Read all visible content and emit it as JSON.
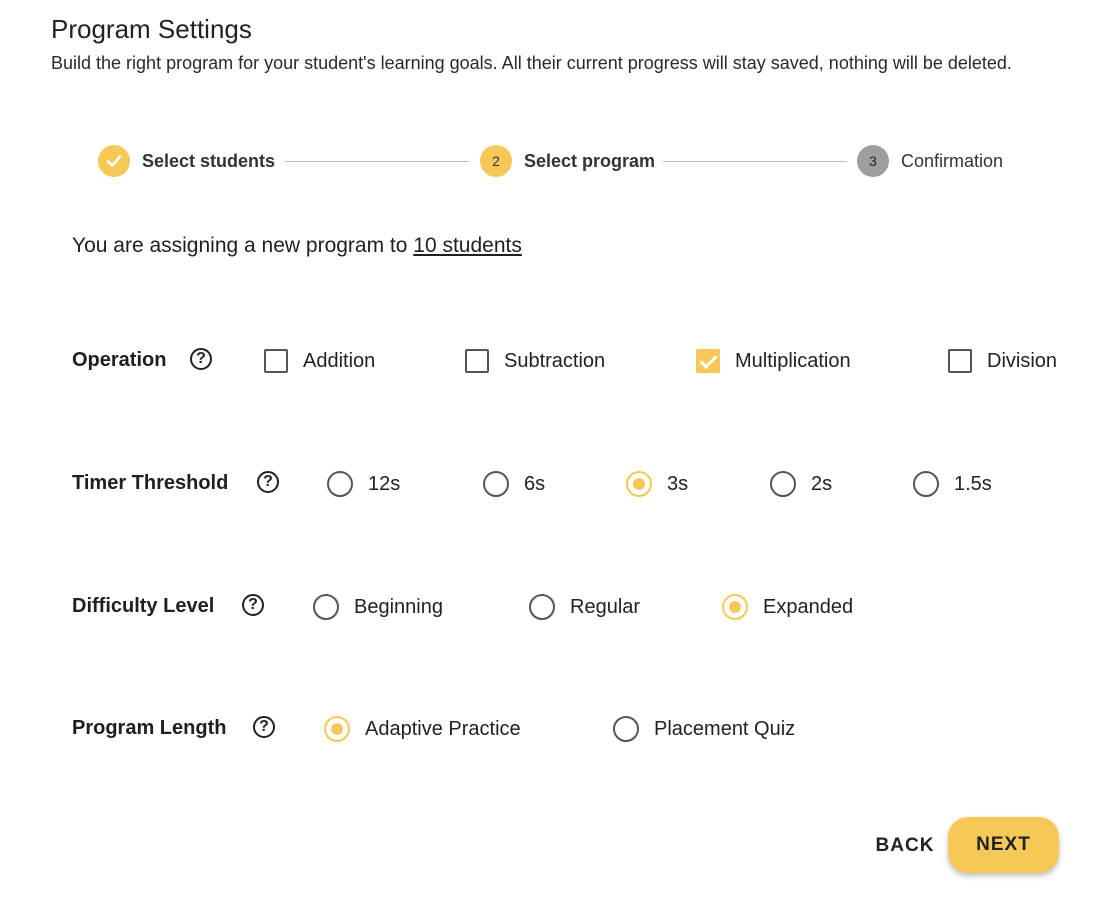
{
  "header": {
    "title": "Program Settings",
    "subtitle": "Build the right program for your student's learning goals. All their current progress will stay saved, nothing will be deleted."
  },
  "stepper": {
    "steps": [
      {
        "number": "1",
        "label": "Select students",
        "state": "done"
      },
      {
        "number": "2",
        "label": "Select program",
        "state": "active"
      },
      {
        "number": "3",
        "label": "Confirmation",
        "state": "pending"
      }
    ]
  },
  "assign": {
    "text": "You are assigning a new program to ",
    "link": "10 students"
  },
  "operation": {
    "label": "Operation",
    "options": [
      {
        "label": "Addition",
        "checked": false
      },
      {
        "label": "Subtraction",
        "checked": false
      },
      {
        "label": "Multiplication",
        "checked": true
      },
      {
        "label": "Division",
        "checked": false
      }
    ]
  },
  "timer": {
    "label": "Timer Threshold",
    "options": [
      {
        "label": "12s",
        "selected": false
      },
      {
        "label": "6s",
        "selected": false
      },
      {
        "label": "3s",
        "selected": true
      },
      {
        "label": "2s",
        "selected": false
      },
      {
        "label": "1.5s",
        "selected": false
      }
    ]
  },
  "difficulty": {
    "label": "Difficulty Level",
    "options": [
      {
        "label": "Beginning",
        "selected": false
      },
      {
        "label": "Regular",
        "selected": false
      },
      {
        "label": "Expanded",
        "selected": true
      }
    ]
  },
  "length": {
    "label": "Program Length",
    "options": [
      {
        "label": "Adaptive Practice",
        "selected": true
      },
      {
        "label": "Placement Quiz",
        "selected": false
      }
    ]
  },
  "help_glyph": "?",
  "icons": {
    "help": "help-circle-icon",
    "step_done": "check-icon"
  },
  "colors": {
    "accent": "#f5c857",
    "pending": "#9e9e9e"
  },
  "buttons": {
    "back": "BACK",
    "next": "NEXT"
  }
}
